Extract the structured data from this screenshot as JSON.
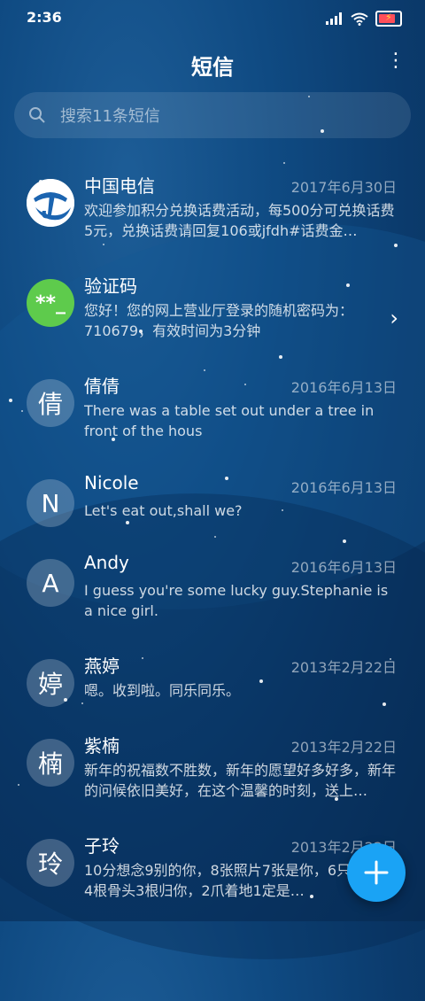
{
  "status_bar": {
    "time": "2:36",
    "icons": [
      "signal-icon",
      "wifi-icon",
      "battery-charging-icon"
    ]
  },
  "header": {
    "title": "短信",
    "menu_icon": "more-vertical-icon"
  },
  "search": {
    "placeholder": "搜索11条短信",
    "value": ""
  },
  "conversations": [
    {
      "name": "中国电信",
      "date": "2017年6月30日",
      "preview": "欢迎参加积分兑换话费活动，每500分可兑换话费5元，兑换话费请回复106或jfdh#话费金…",
      "avatar": "china-telecom-logo"
    },
    {
      "name": "验证码",
      "date": "",
      "preview": "您好！您的网上营业厅登录的随机密码为：710679，有效时间为3分钟",
      "avatar": "**_"
    },
    {
      "name": "倩倩",
      "date": "2016年6月13日",
      "preview": "There was a table set out under a tree in front of the hous",
      "avatar": "倩"
    },
    {
      "name": "Nicole",
      "date": "2016年6月13日",
      "preview": "Let's eat out,shall we?",
      "avatar": "N"
    },
    {
      "name": "Andy",
      "date": "2016年6月13日",
      "preview": "I guess you're some lucky guy.Stephanie is a nice girl.",
      "avatar": "A"
    },
    {
      "name": "燕婷",
      "date": "2013年2月22日",
      "preview": "嗯。收到啦。同乐同乐。",
      "avatar": "婷"
    },
    {
      "name": "紫楠",
      "date": "2013年2月22日",
      "preview": "新年的祝福数不胜数，新年的愿望好多好多，新年的问候依旧美好，在这个温馨的时刻，送上…",
      "avatar": "楠"
    },
    {
      "name": "子玲",
      "date": "2013年2月22日",
      "preview": "10分想念9别的你，8张照片7张是你，6只像你，4根骨头3根归你，2爪着地1定是…",
      "avatar": "玲"
    }
  ],
  "fab": {
    "icon": "plus-icon"
  }
}
